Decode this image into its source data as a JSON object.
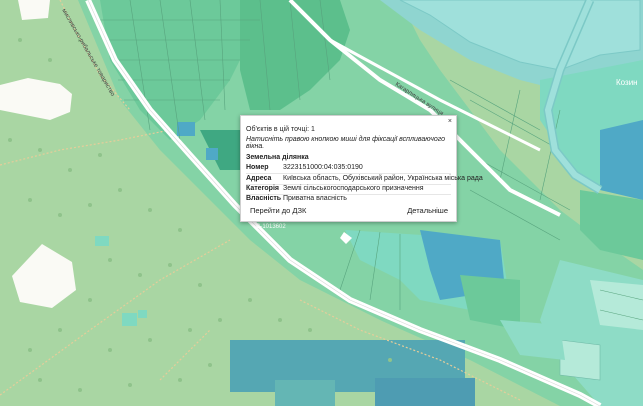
{
  "map": {
    "colors": {
      "forest": "#a9d6a3",
      "forest_dark": "#9fcf99",
      "parcel_green": "#6cc99a",
      "parcel_teal": "#7fd9c1",
      "parcel_mint": "#b5ead9",
      "parcel_blue": "#4fa9c6",
      "water": "#8fd5d0",
      "road": "#ffffff",
      "path": "#e3cfa3"
    },
    "labels": {
      "road_left": "Дорога",
      "road_left_2": "мисливсько-рибальське товариство",
      "road_right": "Кагарлицька вулиця",
      "place_right": "Козин",
      "road_code": "С-1013602"
    }
  },
  "popup": {
    "count_line": "Об'єктів в цій точці: 1",
    "hint": "Натисніть правою кнопкою миші для фіксації вспливаючого вікна.",
    "section_title": "Земельна ділянка",
    "rows": [
      {
        "key": "Номер",
        "value": "3223151000:04:035:0190"
      },
      {
        "key": "Адреса",
        "value": "Київська область, Обухівський район, Українська міська рада"
      },
      {
        "key": "Категорія",
        "value": "Землі сільськогосподарського призначення"
      },
      {
        "key": "Власність",
        "value": "Приватна власність"
      }
    ],
    "close_symbol": "×",
    "goto_label": "Перейти до ДЗК",
    "details_label": "Детальніше"
  }
}
